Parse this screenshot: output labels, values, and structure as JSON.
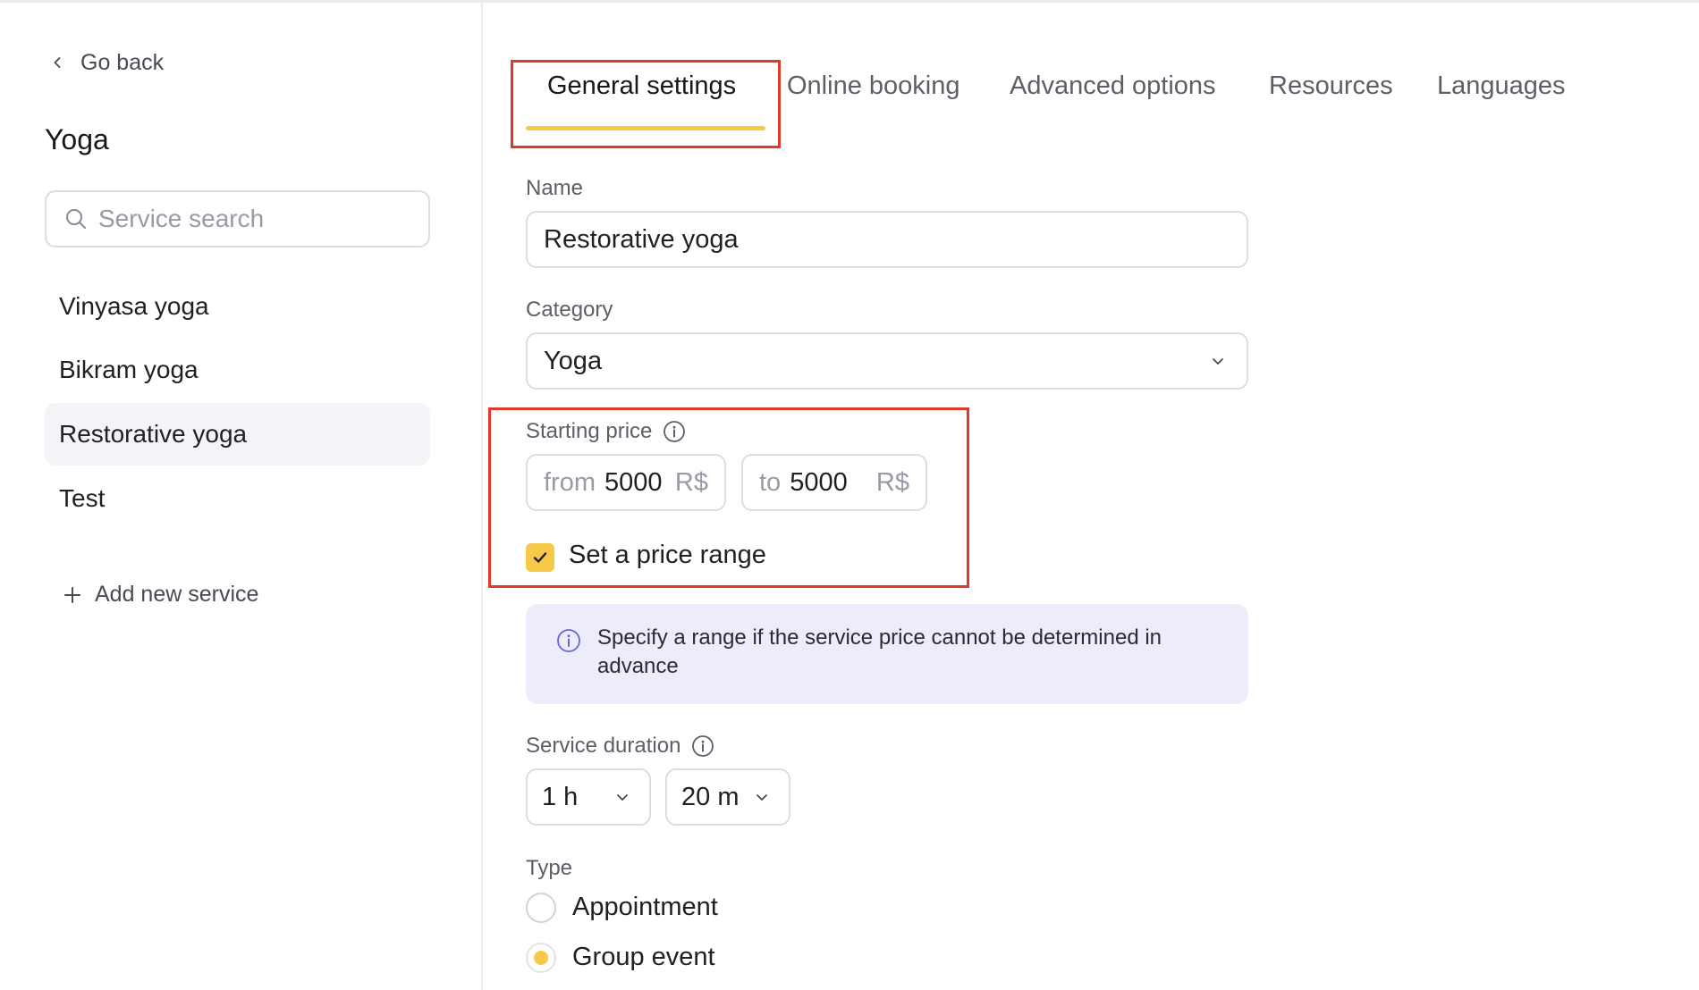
{
  "sidebar": {
    "go_back_label": "Go back",
    "title": "Yoga",
    "search_placeholder": "Service search",
    "services": [
      {
        "label": "Vinyasa yoga"
      },
      {
        "label": "Bikram yoga"
      },
      {
        "label": "Restorative yoga"
      },
      {
        "label": "Test"
      }
    ],
    "active_service": "Restorative yoga",
    "add_label": "Add new service"
  },
  "tabs": [
    {
      "label": "General settings"
    },
    {
      "label": "Online booking"
    },
    {
      "label": "Advanced options"
    },
    {
      "label": "Resources"
    },
    {
      "label": "Languages"
    }
  ],
  "active_tab": "General settings",
  "form": {
    "name_label": "Name",
    "name_value": "Restorative yoga",
    "category_label": "Category",
    "category_value": "Yoga",
    "price_label": "Starting price",
    "price_from_prefix": "from",
    "price_from_value": "5000",
    "price_to_prefix": "to",
    "price_to_value": "5000",
    "currency": "R$",
    "range_checkbox_label": "Set a price range",
    "range_checked": true,
    "info_text": "Specify a range if the service price cannot be determined in advance",
    "duration_label": "Service duration",
    "duration_hours": "1 h",
    "duration_minutes": "20 m",
    "type_label": "Type",
    "type_options": [
      {
        "label": "Appointment",
        "checked": false
      },
      {
        "label": "Group event",
        "checked": true
      }
    ]
  },
  "colors": {
    "accent": "#f7c948",
    "highlight_box": "#e03a2c",
    "info_bg": "#ececfb",
    "info_icon": "#6b63d9",
    "active_item_bg": "#f4f4f8"
  }
}
